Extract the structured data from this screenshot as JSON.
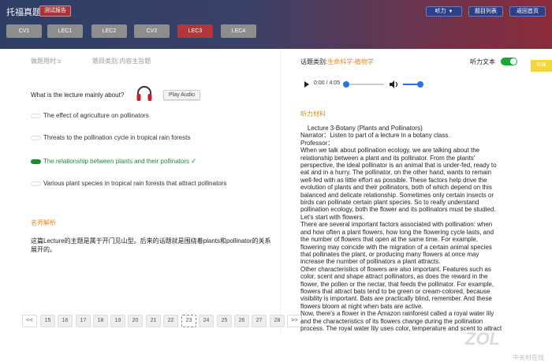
{
  "header": {
    "app_title": "托福真题2",
    "report_label": "测试报告",
    "listen_label": "听力",
    "listen_caret": "▼",
    "question_list_label": "题目列表",
    "home_label": "返回首页"
  },
  "tabs": [
    {
      "label": "CV1"
    },
    {
      "label": "LEC1"
    },
    {
      "label": "LEC2"
    },
    {
      "label": "CV2"
    },
    {
      "label": "LEC3"
    },
    {
      "label": "LEC4"
    }
  ],
  "left": {
    "time_used": "做题用时:s",
    "category": "题目类别:内容主旨题",
    "question": "What is the lecture mainly about?",
    "play_audio": "Play Audio",
    "options": [
      {
        "text": "The effect of agriculture on pollinators",
        "correct": false
      },
      {
        "text": "Threats to the pollination cycle in tropical rain forests",
        "correct": false
      },
      {
        "text": "The relationship between plants and their pollinators",
        "correct": true
      },
      {
        "text": "Various plant species in tropical rain forests that attract pollinators",
        "correct": false
      }
    ],
    "check_mark": "✓",
    "analysis_title": "名师解析",
    "analysis_text": "这篇Lecture的主题是属于开门见山型。后来的话题就是围绕着plants和pollinator的关系展开的。"
  },
  "pagination": {
    "prev": "<<",
    "next": ">>",
    "pages": [
      "15",
      "16",
      "17",
      "18",
      "19",
      "20",
      "21",
      "22",
      "23",
      "24",
      "25",
      "26",
      "27",
      "28"
    ],
    "current": "23"
  },
  "right": {
    "category_label": "话题类别:",
    "category_value": "生命科学-植物学",
    "text_toggle_label": "听力文本",
    "side_tab": "扫描",
    "player_time": "0:00 / 4:05",
    "material_title": "听力材料",
    "transcript": [
      "    Lecture 3-Botany (Plants and Pollinators)",
      "Narrator：Listen to part of a lecture in a botany class.",
      "Professor：",
      "When we talk about pollination ecology, we are talking about the",
      "relationship between a plant and its pollinator. From the plants'",
      "perspective, the ideal pollinator is an animal that is under-fed, ready to",
      "eat and in a hurry. The pollinator, on the other hand, wants to remain",
      "well-fed with as little effort as possible. These factors help drive the",
      "evolution of plants and their pollinators, both of which depend on this",
      "balanced and delicate relationship. Sometimes only certain insects or",
      "birds can pollinate certain plant species. So to really understand",
      "pollination ecology, both the flower and its pollinators must be studied.",
      "Let's start with flowers.",
      "There are several important factors associated with pollination: when",
      "and how often a plant flowers, how long the flowering cycle lasts, and",
      "the number of flowers that open at the same time. For example,",
      "flowering may coincide with the migration of a certain animal species",
      "that pollinates the plant, or producing many flowers at once may",
      "increase the number of pollinators a plant attracts.",
      "Other characteristics of flowers are also important. Features such as",
      "color, scent and shape attract pollinators, as does the reward in the",
      "flower, the pollen or the nectar, that feeds the pollinator. For example,",
      "flowers that attract bats tend to be green or cream-colored, because",
      "visibility is important. Bats are practically blind, remember. And these",
      "flowers bloom at night when bats are active.",
      "Now, there's a flower in the Amazon rainforest called a royal water lily",
      "and the characteristics of its flowers change during the pollination",
      "process. The royal water lily uses color, temperature and scent to attract"
    ]
  },
  "watermark": "ZOL",
  "watermark_sub": "中关村在线"
}
